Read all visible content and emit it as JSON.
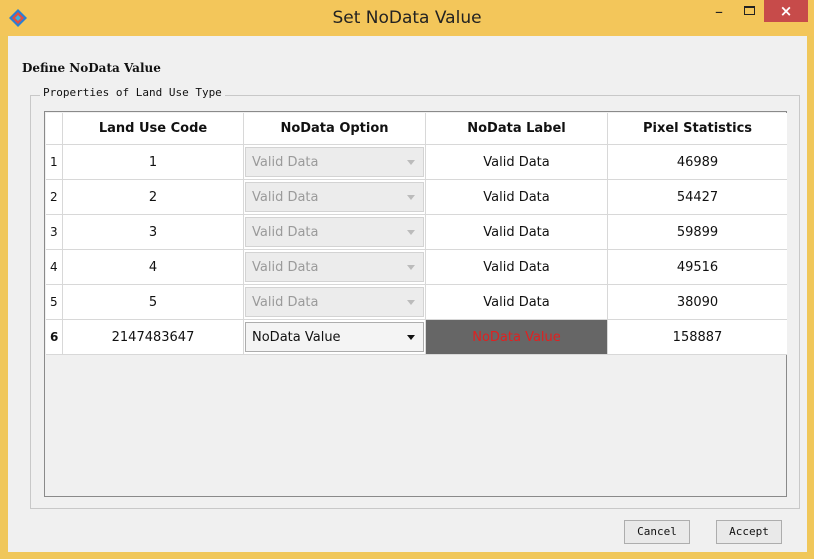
{
  "window": {
    "title": "Set NoData Value",
    "minimize_glyph": "–",
    "close_glyph": "×"
  },
  "colors": {
    "titlebar": "#f3c65a",
    "close_button": "#c74b4a",
    "nodata_fill": "#666666",
    "nodata_text": "#e02020"
  },
  "section": {
    "heading": "Define NoData Value",
    "group_title": "Properties of Land Use Type"
  },
  "table": {
    "headers": [
      "Land Use Code",
      "NoData Option",
      "NoData Label",
      "Pixel Statistics"
    ],
    "rows": [
      {
        "num": "1",
        "code": "1",
        "option": "Valid Data",
        "label": "Valid Data",
        "pixels": "46989"
      },
      {
        "num": "2",
        "code": "2",
        "option": "Valid Data",
        "label": "Valid Data",
        "pixels": "54427"
      },
      {
        "num": "3",
        "code": "3",
        "option": "Valid Data",
        "label": "Valid Data",
        "pixels": "59899"
      },
      {
        "num": "4",
        "code": "4",
        "option": "Valid Data",
        "label": "Valid Data",
        "pixels": "49516"
      },
      {
        "num": "5",
        "code": "5",
        "option": "Valid Data",
        "label": "Valid Data",
        "pixels": "38090"
      },
      {
        "num": "6",
        "code": "2147483647",
        "option": "NoData Value",
        "label": "NoData Value",
        "pixels": "158887"
      }
    ]
  },
  "buttons": {
    "cancel": "Cancel",
    "accept": "Accept"
  }
}
